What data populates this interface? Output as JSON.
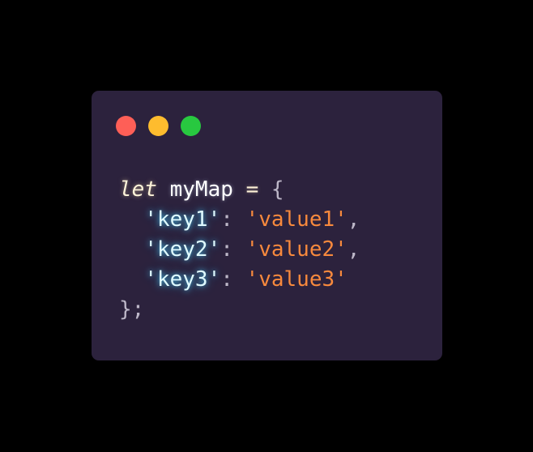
{
  "window": {
    "background": "#2c223d",
    "controls": [
      {
        "name": "close",
        "color": "#fe5f57"
      },
      {
        "name": "minimize",
        "color": "#febc2e"
      },
      {
        "name": "maximize",
        "color": "#28c840"
      }
    ]
  },
  "code": {
    "keyword": "let",
    "variable": "myMap",
    "assign": "=",
    "open_brace": "{",
    "entries": [
      {
        "key": "'key1'",
        "colon": ":",
        "value": "'value1'",
        "comma": ","
      },
      {
        "key": "'key2'",
        "colon": ":",
        "value": "'value2'",
        "comma": ","
      },
      {
        "key": "'key3'",
        "colon": ":",
        "value": "'value3'",
        "comma": ""
      }
    ],
    "close": "};"
  },
  "colors": {
    "page_background": "#000000",
    "keyword": "#fdf3d9",
    "key": "#dffaff",
    "string": "#f7893d",
    "punctuation": "#bdb7c8"
  }
}
